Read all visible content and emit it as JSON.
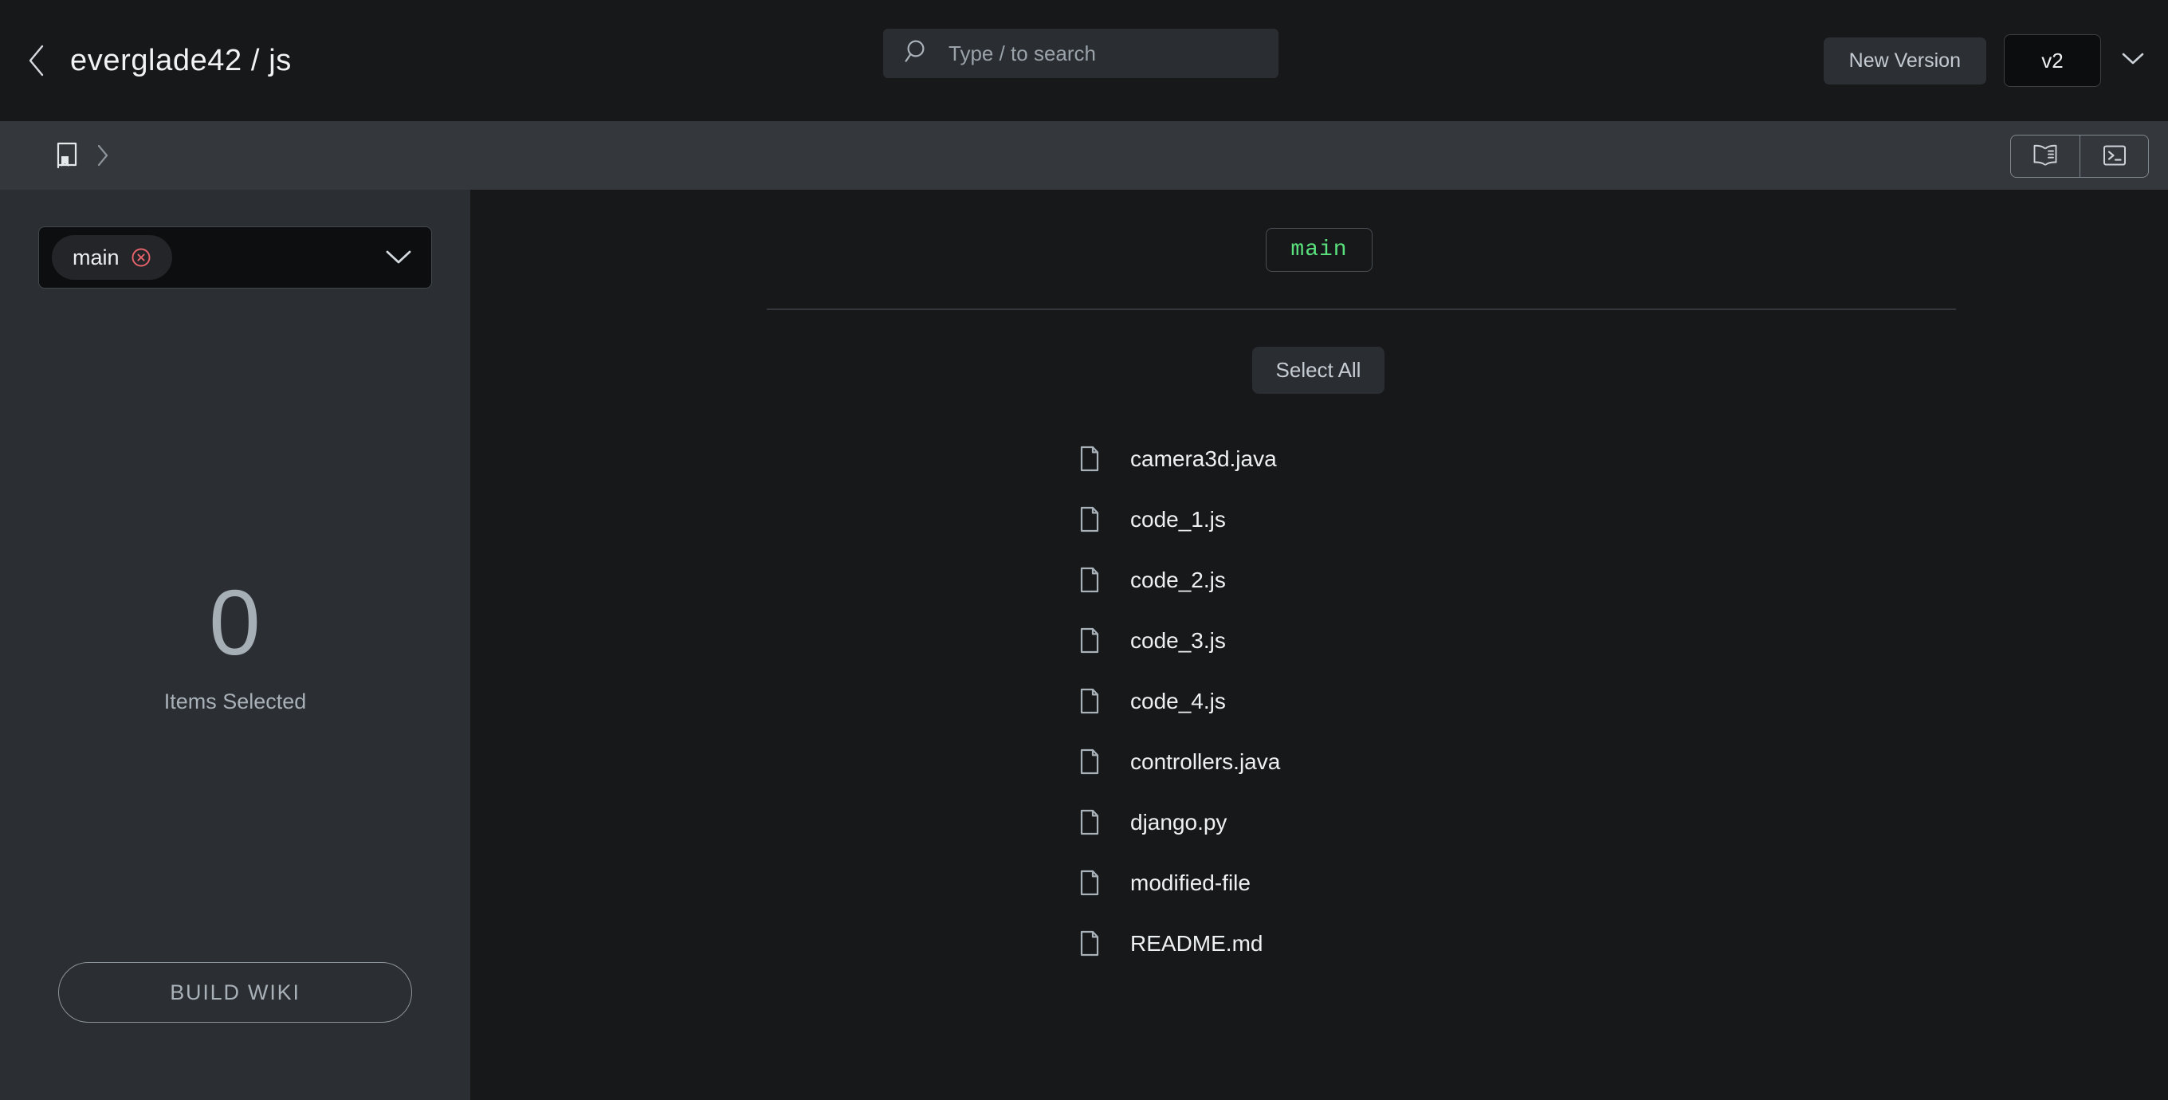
{
  "header": {
    "back_icon": "chevron-left-icon",
    "title": "everglade42 / js",
    "search": {
      "icon": "search-icon",
      "placeholder": "Type / to search",
      "value": ""
    },
    "new_version_label": "New Version",
    "version_value": "v2",
    "version_chevron_icon": "chevron-down-icon"
  },
  "toolbar": {
    "repo_icon": "book-bookmark-icon",
    "separator_icon": "chevron-right-icon",
    "views": [
      {
        "name": "wiki-view",
        "icon": "open-book-icon"
      },
      {
        "name": "terminal-view",
        "icon": "terminal-icon"
      }
    ]
  },
  "sidebar": {
    "branch_selector": {
      "chip_label": "main",
      "chip_remove_icon": "circle-x-icon",
      "chevron_icon": "chevron-down-icon"
    },
    "selection": {
      "count": "0",
      "label": "Items Selected"
    },
    "build_wiki_label": "BUILD WIKI"
  },
  "main": {
    "branch_badge": "main",
    "select_all_label": "Select All",
    "files": [
      {
        "name": "camera3d.java",
        "icon": "file-icon"
      },
      {
        "name": "code_1.js",
        "icon": "file-icon"
      },
      {
        "name": "code_2.js",
        "icon": "file-icon"
      },
      {
        "name": "code_3.js",
        "icon": "file-icon"
      },
      {
        "name": "code_4.js",
        "icon": "file-icon"
      },
      {
        "name": "controllers.java",
        "icon": "file-icon"
      },
      {
        "name": "django.py",
        "icon": "file-icon"
      },
      {
        "name": "modified-file",
        "icon": "file-icon"
      },
      {
        "name": "README.md",
        "icon": "file-icon"
      }
    ]
  },
  "colors": {
    "app_bg": "#16181a",
    "toolbar_bg": "#34373b",
    "sidebar_bg": "#2b2e32",
    "accent_green": "#5ae07d",
    "danger_red": "#e8636c",
    "text_primary": "#eef1f3",
    "text_muted": "#a8b0b8"
  }
}
